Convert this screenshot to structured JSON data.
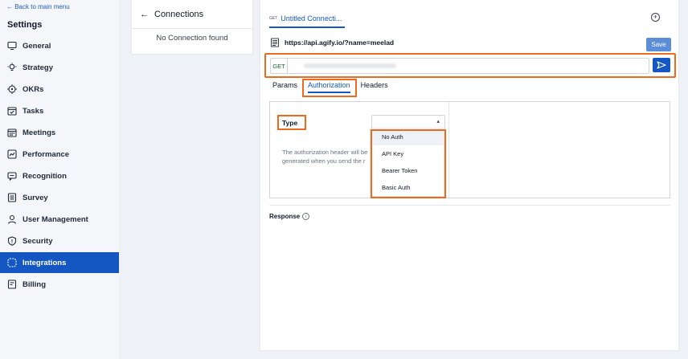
{
  "sidebar": {
    "back_label": "← Back to main menu",
    "title": "Settings",
    "items": [
      {
        "label": "General",
        "icon": "monitor-icon"
      },
      {
        "label": "Strategy",
        "icon": "bulb-icon"
      },
      {
        "label": "OKRs",
        "icon": "target-icon"
      },
      {
        "label": "Tasks",
        "icon": "calendar-check-icon"
      },
      {
        "label": "Meetings",
        "icon": "calendar-icon"
      },
      {
        "label": "Performance",
        "icon": "chart-icon"
      },
      {
        "label": "Recognition",
        "icon": "chat-icon"
      },
      {
        "label": "Survey",
        "icon": "list-icon"
      },
      {
        "label": "User Management",
        "icon": "user-icon"
      },
      {
        "label": "Security",
        "icon": "shield-icon"
      },
      {
        "label": "Integrations",
        "icon": "plug-icon",
        "active": true
      },
      {
        "label": "Billing",
        "icon": "receipt-icon"
      }
    ]
  },
  "connections": {
    "title": "Connections",
    "empty_text": "No Connection found"
  },
  "request": {
    "tab_method": "GET",
    "tab_title": "Untitled Connecti...",
    "plus_label": "+",
    "url_display": "https://api.agify.io/?name=meelad",
    "save_label": "Save",
    "method": "GET"
  },
  "subtabs": [
    "Params",
    "Authorization",
    "Headers"
  ],
  "auth": {
    "type_label": "Type",
    "description": "The authorization header will be generated when you send the r",
    "options": [
      "No Auth",
      "API Key",
      "Bearer Token",
      "Basic Auth"
    ]
  },
  "response": {
    "label": "Response"
  },
  "colors": {
    "accent": "#1457c2",
    "highlight": "#ee6a1f",
    "save": "#5b8dd9"
  }
}
